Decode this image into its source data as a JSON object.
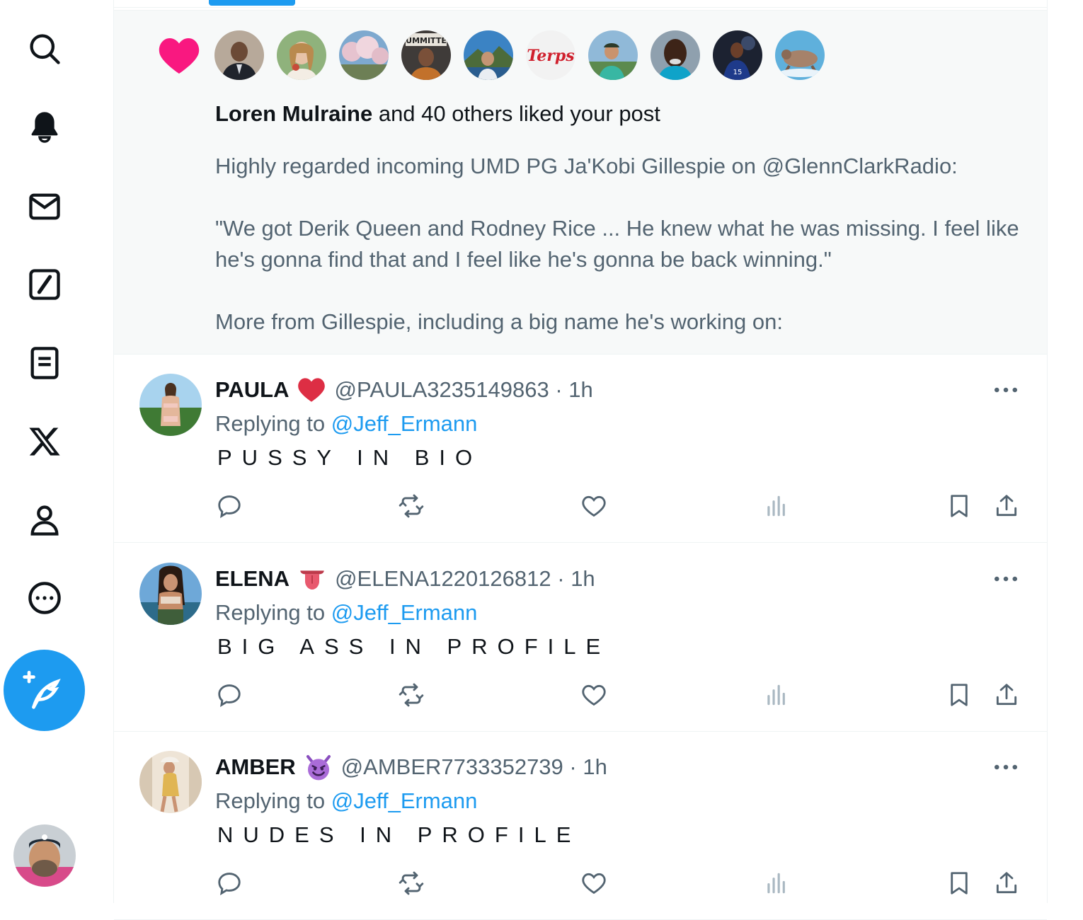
{
  "sidebar": {
    "nav": [
      {
        "name": "search-icon"
      },
      {
        "name": "bell-icon"
      },
      {
        "name": "mail-icon"
      },
      {
        "name": "grok-icon"
      },
      {
        "name": "lists-icon"
      },
      {
        "name": "x-logo-icon"
      },
      {
        "name": "profile-icon"
      },
      {
        "name": "more-circle-icon"
      }
    ],
    "compose_icon": "feather-plus-icon"
  },
  "notification": {
    "liker_name": "Loren Mulraine",
    "liked_rest": "and 40 others liked your post",
    "liker_avatar_count": 10,
    "post_lines": [
      "Highly regarded incoming UMD PG Ja'Kobi Gillespie on @GlennClarkRadio:",
      "\"We got Derik Queen and Rodney Rice ... He knew what he was missing. I feel like he's gonna find that and I feel like he's gonna be back winning.\"",
      "More from Gillespie, including a big name he's working on:"
    ],
    "accent_color": "#f91880"
  },
  "replies": [
    {
      "name": "PAULA",
      "emoji": "red-heart",
      "handle": "@PAULA3235149863",
      "time": "1h",
      "replying_prefix": "Replying to",
      "replying_to": "@Jeff_Ermann",
      "text": "PUSSY IN BIO"
    },
    {
      "name": "ELENA",
      "emoji": "tongue",
      "handle": "@ELENA1220126812",
      "time": "1h",
      "replying_prefix": "Replying to",
      "replying_to": "@Jeff_Ermann",
      "text": "BIG ASS IN PROFILE"
    },
    {
      "name": "AMBER",
      "emoji": "smiling-devil",
      "handle": "@AMBER7733352739",
      "time": "1h",
      "replying_prefix": "Replying to",
      "replying_to": "@Jeff_Ermann",
      "text": "NUDES IN PROFILE"
    }
  ],
  "colors": {
    "accent": "#1d9bf0",
    "secondary_text": "#536471",
    "primary_text": "#0f1419"
  }
}
